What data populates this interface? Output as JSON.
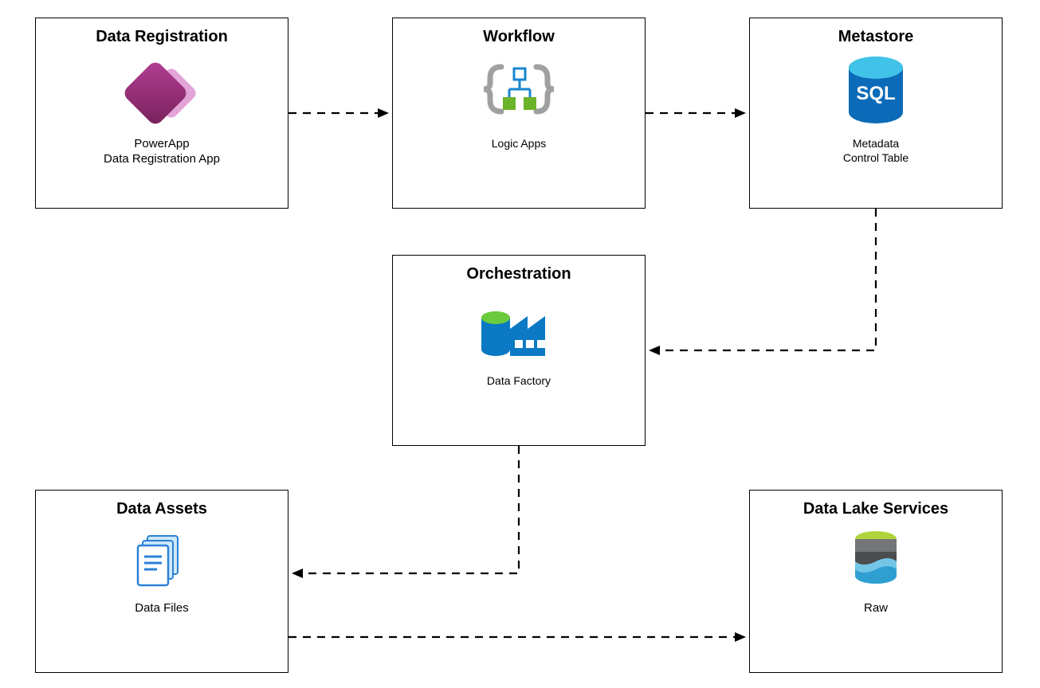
{
  "nodes": {
    "dataRegistration": {
      "title": "Data Registration",
      "caption": "PowerApp\nData Registration App"
    },
    "workflow": {
      "title": "Workflow",
      "caption": "Logic Apps"
    },
    "metastore": {
      "title": "Metastore",
      "caption": "Metadata\nControl Table"
    },
    "orchestration": {
      "title": "Orchestration",
      "caption": "Data Factory"
    },
    "dataAssets": {
      "title": "Data Assets",
      "caption": "Data Files"
    },
    "dataLakeServices": {
      "title": "Data Lake Services",
      "caption": "Raw"
    }
  },
  "edges": [
    {
      "from": "dataRegistration",
      "to": "workflow"
    },
    {
      "from": "workflow",
      "to": "metastore"
    },
    {
      "from": "metastore",
      "to": "orchestration"
    },
    {
      "from": "orchestration",
      "to": "dataAssets"
    },
    {
      "from": "dataAssets",
      "to": "dataLakeServices"
    }
  ]
}
